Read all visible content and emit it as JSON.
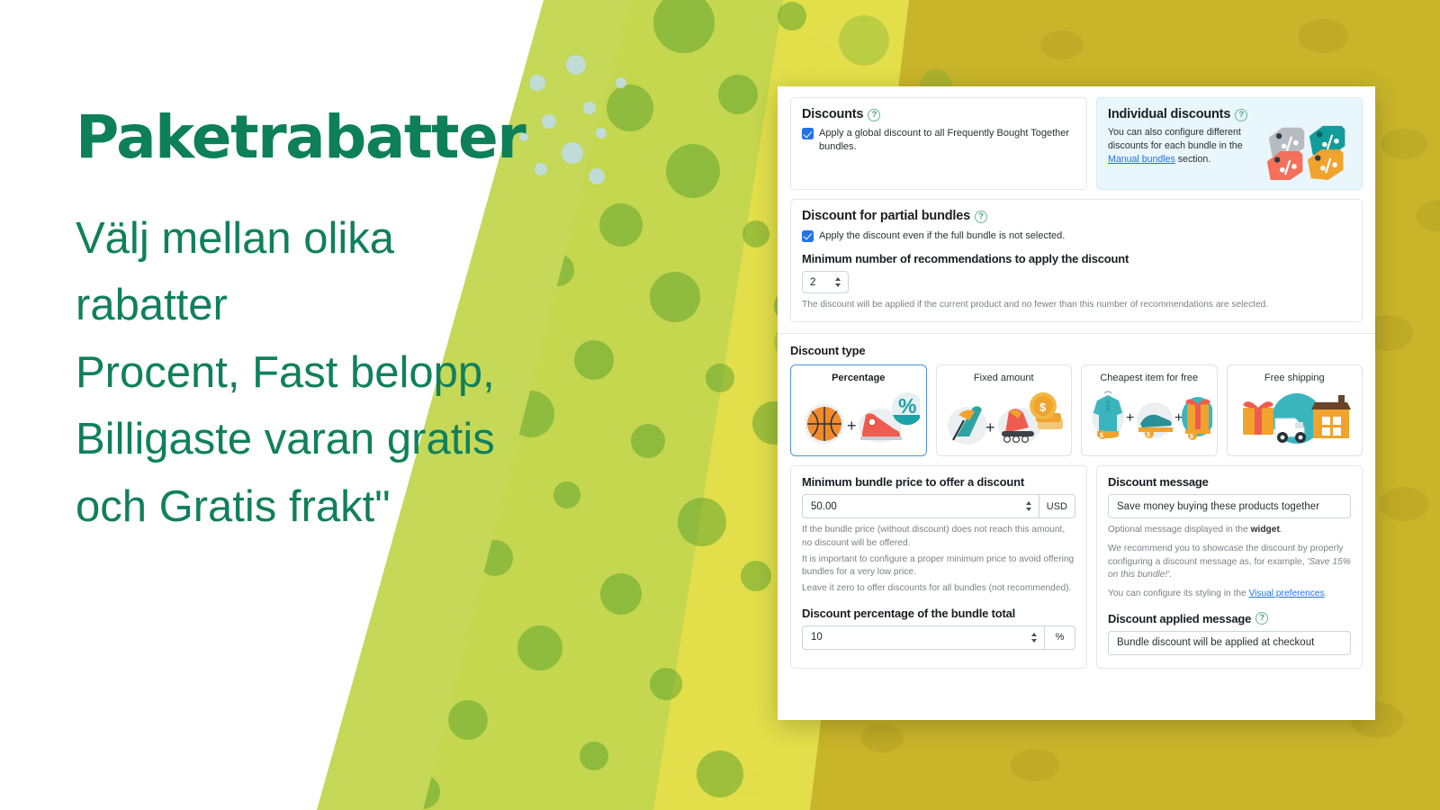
{
  "marketing": {
    "headline": "Paketrabatter",
    "lines": [
      "Välj mellan olika",
      "rabatter",
      "Procent, Fast belopp,",
      "Billigaste varan gratis",
      "och Gratis frakt\""
    ],
    "colors": {
      "heading_green": "#0d8059",
      "band_green": "#8cc152",
      "band_lime": "#c6d84a",
      "band_yellow": "#e8e24a",
      "band_gold": "#c9b023",
      "dot_teal": "#bfdcd6"
    }
  },
  "panel": {
    "discounts": {
      "title": "Discounts",
      "help_icon": "help-circle-icon",
      "checkbox_checked": true,
      "checkbox_label": "Apply a global discount to all Frequently Bought Together bundles."
    },
    "individual_discounts": {
      "title": "Individual discounts",
      "help_icon": "help-circle-icon",
      "text_before": "You can also configure different discounts for each bundle in the ",
      "link": "Manual bundles",
      "text_after": " section.",
      "art_icon": "discount-tags-icon"
    },
    "partial_bundles": {
      "title": "Discount for partial bundles",
      "help_icon": "help-circle-icon",
      "checkbox_checked": true,
      "checkbox_label": "Apply the discount even if the full bundle is not selected.",
      "min_recs_label": "Minimum number of recommendations to apply the discount",
      "min_recs_value": "2",
      "hint": "The discount will be applied if the current product and no fewer than this number of recommendations are selected."
    },
    "discount_type": {
      "label": "Discount type",
      "selected": "Percentage",
      "options": [
        {
          "label": "Percentage",
          "art": "basketball-sneaker-percent-icon",
          "selected": true
        },
        {
          "label": "Fixed amount",
          "art": "skateboard-rollerskate-coins-icon",
          "selected": false
        },
        {
          "label": "Cheapest item for free",
          "art": "hoodie-sneaker-gift-icon",
          "selected": false
        },
        {
          "label": "Free shipping",
          "art": "gift-truck-house-icon",
          "selected": false
        }
      ]
    },
    "min_price": {
      "label": "Minimum bundle price to offer a discount",
      "value": "50.00",
      "unit": "USD",
      "hint_1": "If the bundle price (without discount) does not reach this amount, no discount will be offered.",
      "hint_2": "It is important to configure a proper minimum price to avoid offering bundles for a very low price.",
      "hint_3": "Leave it zero to offer discounts for all bundles (not recommended)."
    },
    "discount_percentage": {
      "label": "Discount percentage of the bundle total",
      "value": "10",
      "unit": "%"
    },
    "discount_message": {
      "label": "Discount message",
      "value": "Save money buying these products together",
      "hint_a_pre": "Optional message displayed in the ",
      "hint_a_bold": "widget",
      "hint_a_post": ".",
      "hint_b_pre": "We recommend you to showcase the discount by properly configuring a discount message as, for example, ",
      "hint_b_italic": "'Save 15% on this bundle!'",
      "hint_b_post": ".",
      "hint_c_pre": "You can configure its styling in the ",
      "hint_c_link": "Visual preferences",
      "hint_c_post": "."
    },
    "discount_applied_message": {
      "label": "Discount applied message",
      "help_icon": "help-circle-icon",
      "value": "Bundle discount will be applied at checkout"
    }
  }
}
